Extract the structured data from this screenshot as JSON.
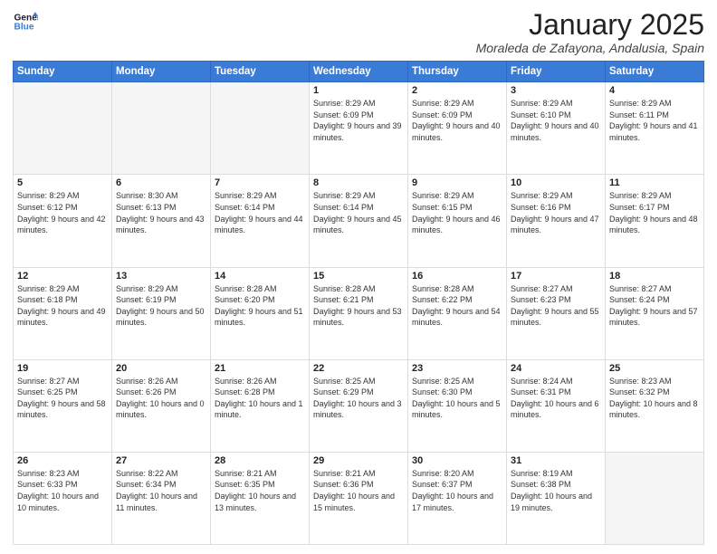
{
  "header": {
    "logo_line1": "General",
    "logo_line2": "Blue",
    "month_year": "January 2025",
    "location": "Moraleda de Zafayona, Andalusia, Spain"
  },
  "weekdays": [
    "Sunday",
    "Monday",
    "Tuesday",
    "Wednesday",
    "Thursday",
    "Friday",
    "Saturday"
  ],
  "weeks": [
    [
      {
        "day": "",
        "info": ""
      },
      {
        "day": "",
        "info": ""
      },
      {
        "day": "",
        "info": ""
      },
      {
        "day": "1",
        "info": "Sunrise: 8:29 AM\nSunset: 6:09 PM\nDaylight: 9 hours\nand 39 minutes."
      },
      {
        "day": "2",
        "info": "Sunrise: 8:29 AM\nSunset: 6:09 PM\nDaylight: 9 hours\nand 40 minutes."
      },
      {
        "day": "3",
        "info": "Sunrise: 8:29 AM\nSunset: 6:10 PM\nDaylight: 9 hours\nand 40 minutes."
      },
      {
        "day": "4",
        "info": "Sunrise: 8:29 AM\nSunset: 6:11 PM\nDaylight: 9 hours\nand 41 minutes."
      }
    ],
    [
      {
        "day": "5",
        "info": "Sunrise: 8:29 AM\nSunset: 6:12 PM\nDaylight: 9 hours\nand 42 minutes."
      },
      {
        "day": "6",
        "info": "Sunrise: 8:30 AM\nSunset: 6:13 PM\nDaylight: 9 hours\nand 43 minutes."
      },
      {
        "day": "7",
        "info": "Sunrise: 8:29 AM\nSunset: 6:14 PM\nDaylight: 9 hours\nand 44 minutes."
      },
      {
        "day": "8",
        "info": "Sunrise: 8:29 AM\nSunset: 6:14 PM\nDaylight: 9 hours\nand 45 minutes."
      },
      {
        "day": "9",
        "info": "Sunrise: 8:29 AM\nSunset: 6:15 PM\nDaylight: 9 hours\nand 46 minutes."
      },
      {
        "day": "10",
        "info": "Sunrise: 8:29 AM\nSunset: 6:16 PM\nDaylight: 9 hours\nand 47 minutes."
      },
      {
        "day": "11",
        "info": "Sunrise: 8:29 AM\nSunset: 6:17 PM\nDaylight: 9 hours\nand 48 minutes."
      }
    ],
    [
      {
        "day": "12",
        "info": "Sunrise: 8:29 AM\nSunset: 6:18 PM\nDaylight: 9 hours\nand 49 minutes."
      },
      {
        "day": "13",
        "info": "Sunrise: 8:29 AM\nSunset: 6:19 PM\nDaylight: 9 hours\nand 50 minutes."
      },
      {
        "day": "14",
        "info": "Sunrise: 8:28 AM\nSunset: 6:20 PM\nDaylight: 9 hours\nand 51 minutes."
      },
      {
        "day": "15",
        "info": "Sunrise: 8:28 AM\nSunset: 6:21 PM\nDaylight: 9 hours\nand 53 minutes."
      },
      {
        "day": "16",
        "info": "Sunrise: 8:28 AM\nSunset: 6:22 PM\nDaylight: 9 hours\nand 54 minutes."
      },
      {
        "day": "17",
        "info": "Sunrise: 8:27 AM\nSunset: 6:23 PM\nDaylight: 9 hours\nand 55 minutes."
      },
      {
        "day": "18",
        "info": "Sunrise: 8:27 AM\nSunset: 6:24 PM\nDaylight: 9 hours\nand 57 minutes."
      }
    ],
    [
      {
        "day": "19",
        "info": "Sunrise: 8:27 AM\nSunset: 6:25 PM\nDaylight: 9 hours\nand 58 minutes."
      },
      {
        "day": "20",
        "info": "Sunrise: 8:26 AM\nSunset: 6:26 PM\nDaylight: 10 hours\nand 0 minutes."
      },
      {
        "day": "21",
        "info": "Sunrise: 8:26 AM\nSunset: 6:28 PM\nDaylight: 10 hours\nand 1 minute."
      },
      {
        "day": "22",
        "info": "Sunrise: 8:25 AM\nSunset: 6:29 PM\nDaylight: 10 hours\nand 3 minutes."
      },
      {
        "day": "23",
        "info": "Sunrise: 8:25 AM\nSunset: 6:30 PM\nDaylight: 10 hours\nand 5 minutes."
      },
      {
        "day": "24",
        "info": "Sunrise: 8:24 AM\nSunset: 6:31 PM\nDaylight: 10 hours\nand 6 minutes."
      },
      {
        "day": "25",
        "info": "Sunrise: 8:23 AM\nSunset: 6:32 PM\nDaylight: 10 hours\nand 8 minutes."
      }
    ],
    [
      {
        "day": "26",
        "info": "Sunrise: 8:23 AM\nSunset: 6:33 PM\nDaylight: 10 hours\nand 10 minutes."
      },
      {
        "day": "27",
        "info": "Sunrise: 8:22 AM\nSunset: 6:34 PM\nDaylight: 10 hours\nand 11 minutes."
      },
      {
        "day": "28",
        "info": "Sunrise: 8:21 AM\nSunset: 6:35 PM\nDaylight: 10 hours\nand 13 minutes."
      },
      {
        "day": "29",
        "info": "Sunrise: 8:21 AM\nSunset: 6:36 PM\nDaylight: 10 hours\nand 15 minutes."
      },
      {
        "day": "30",
        "info": "Sunrise: 8:20 AM\nSunset: 6:37 PM\nDaylight: 10 hours\nand 17 minutes."
      },
      {
        "day": "31",
        "info": "Sunrise: 8:19 AM\nSunset: 6:38 PM\nDaylight: 10 hours\nand 19 minutes."
      },
      {
        "day": "",
        "info": ""
      }
    ]
  ]
}
